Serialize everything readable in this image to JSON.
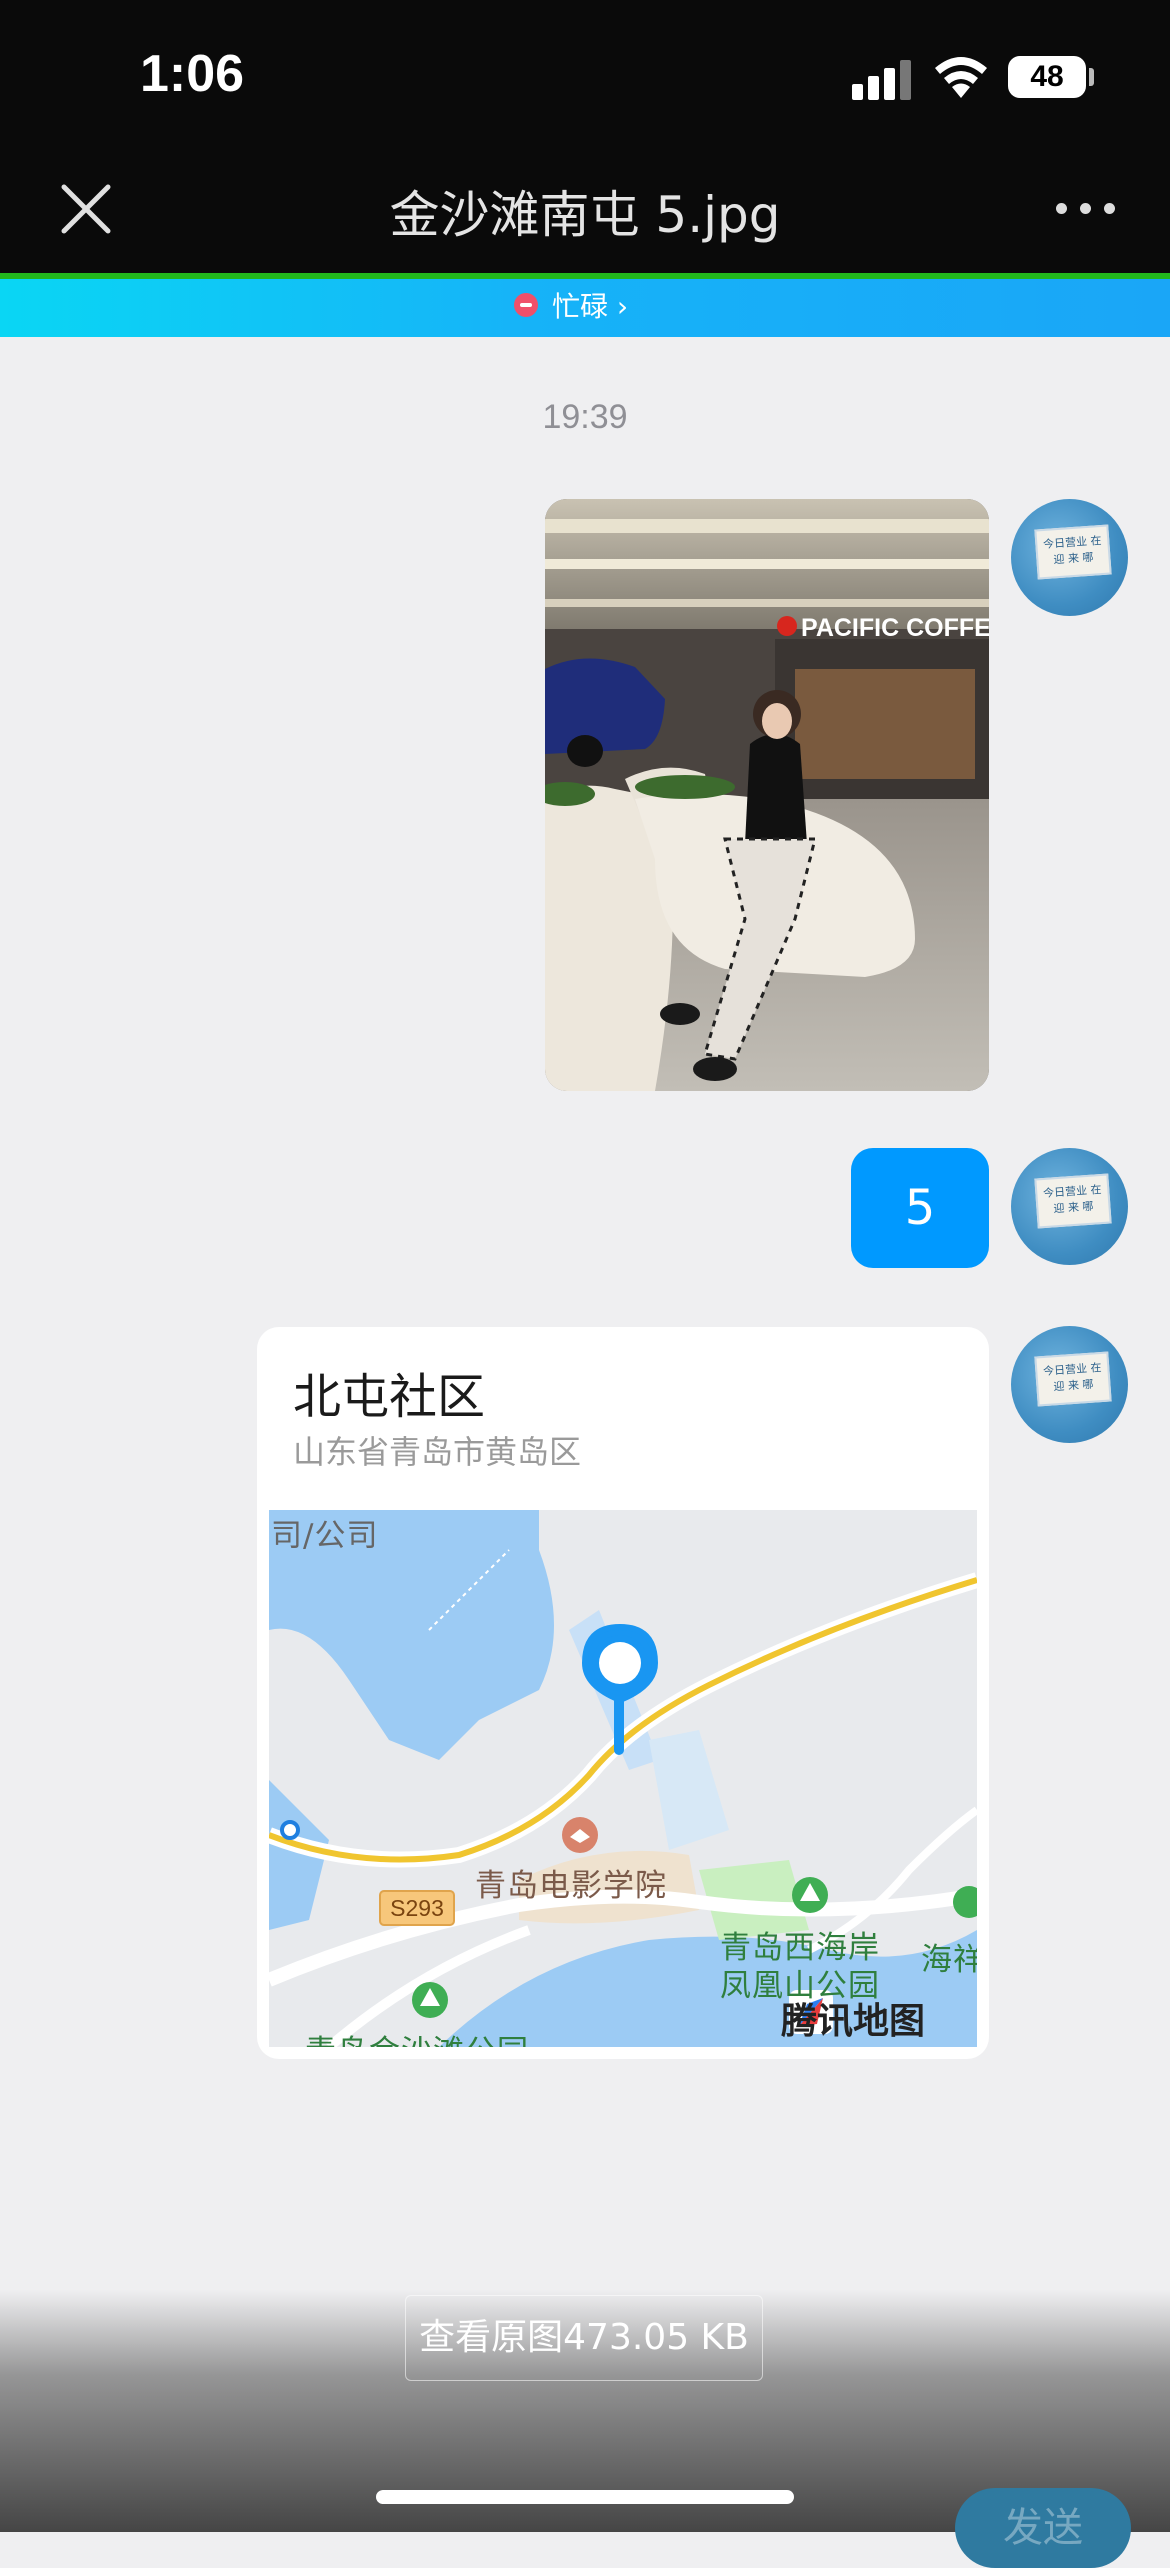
{
  "status_bar": {
    "time": "1:06",
    "battery": "48"
  },
  "header": {
    "title": "金沙滩南屯 5.jpg"
  },
  "chat": {
    "banner_status": "忙碌 ›",
    "timestamp": "19:39",
    "photo": {
      "sign_text": "PACIFIC COFFEE"
    },
    "text_message": "5",
    "location": {
      "title": "北屯社区",
      "subtitle": "山东省青岛市黄岛区",
      "map": {
        "corner_label": "司/公司",
        "road_badge": "S293",
        "labels": [
          "青岛电影学院",
          "青岛西海岸",
          "凤凰山公园",
          "海祥",
          "青岛金沙滩公园"
        ],
        "brand": "腾讯地图"
      }
    },
    "avatar_note": "今日营业 在 迎 来 哪"
  },
  "footer": {
    "view_original": "查看原图473.05 KB",
    "send": "发送"
  }
}
